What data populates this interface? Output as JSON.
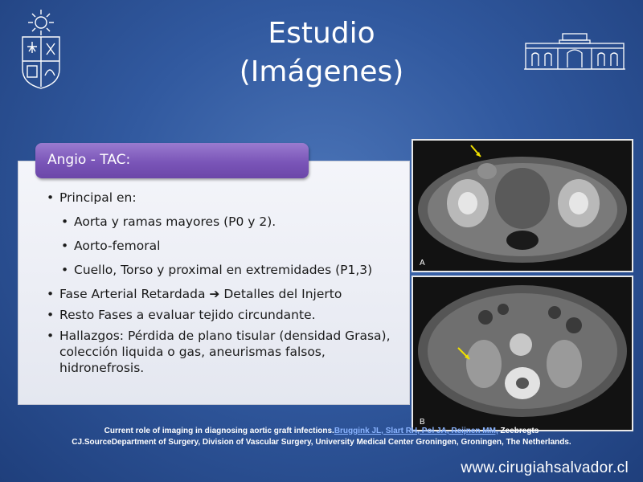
{
  "slide": {
    "title_line1": "Estudio",
    "title_line2": "(Imágenes)"
  },
  "panel": {
    "header": "Angio - TAC:",
    "bullets": [
      {
        "text": "Principal en:"
      },
      {
        "text": " Aorta y ramas mayores (P0 y 2)."
      },
      {
        "text": "Aorto-femoral"
      },
      {
        "text": "Cuello, Torso y proximal en extremidades (P1,3)"
      },
      {
        "text_before": "Fase Arterial Retardada ",
        "text_after": " Detalles del Injerto",
        "arrow_glyph": "➔"
      },
      {
        "text": "Resto Fases a evaluar tejido circundante."
      },
      {
        "text": "Hallazgos: Pérdida de plano tisular (densidad Grasa), colección liquida o gas, aneurismas falsos, hidronefrosis."
      }
    ]
  },
  "images": {
    "top_label": "A",
    "bottom_label": "B"
  },
  "reference": {
    "prefix": "Current role of imaging in diagnosing aortic graft infections.",
    "authors_link": "Bruggink JL, Slart RH, Pol JA, Reijnen MM,",
    "suffix_line1": " Zeebregts",
    "line2": "CJ.SourceDepartment of Surgery, Division of Vascular Surgery, University Medical Center Groningen, Groningen, The Netherlands."
  },
  "footer_url": "www.cirugiahsalvador.cl",
  "icons": {
    "left_logo": "university-crest-icon",
    "right_logo": "hospital-building-icon"
  },
  "colors": {
    "background": "#31599f",
    "header_purple": "#7a55b8",
    "link_blue": "#8ab4ff"
  }
}
